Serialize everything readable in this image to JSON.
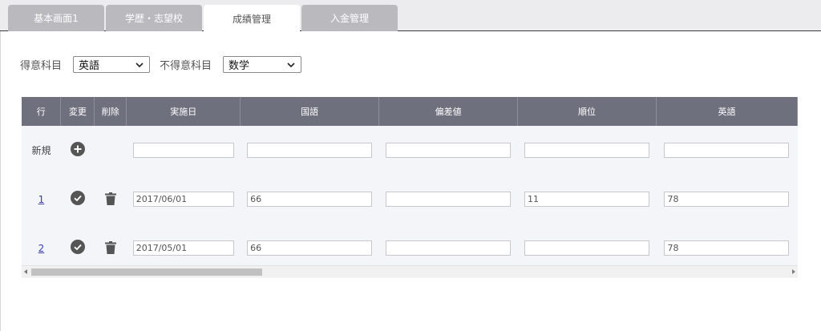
{
  "tabs": [
    {
      "label": "基本画面1",
      "active": false
    },
    {
      "label": "学歴・志望校",
      "active": false
    },
    {
      "label": "成績管理",
      "active": true
    },
    {
      "label": "入金管理",
      "active": false
    }
  ],
  "filters": {
    "strong_label": "得意科目",
    "strong_value": "英語",
    "weak_label": "不得意科目",
    "weak_value": "数学"
  },
  "table": {
    "headers": [
      "行",
      "変更",
      "削除",
      "実施日",
      "国語",
      "偏差値",
      "順位",
      "英語"
    ],
    "new_row_label": "新規",
    "rows": [
      {
        "no": "1",
        "date": "2017/06/01",
        "kokugo": "66",
        "hensachi": "",
        "juni": "11",
        "eigo": "78"
      },
      {
        "no": "2",
        "date": "2017/05/01",
        "kokugo": "66",
        "hensachi": "",
        "juni": "",
        "eigo": "78"
      }
    ]
  },
  "icons": {
    "add": "plus-circle-icon",
    "confirm": "check-circle-icon",
    "delete": "trash-icon",
    "dropdown": "chevron-down-icon"
  },
  "colors": {
    "header_bg": "#6f707e",
    "tab_inactive": "#b9b9be",
    "grid_bg": "#f4f5f9",
    "link": "#3b3bb3",
    "icon": "#555555"
  }
}
